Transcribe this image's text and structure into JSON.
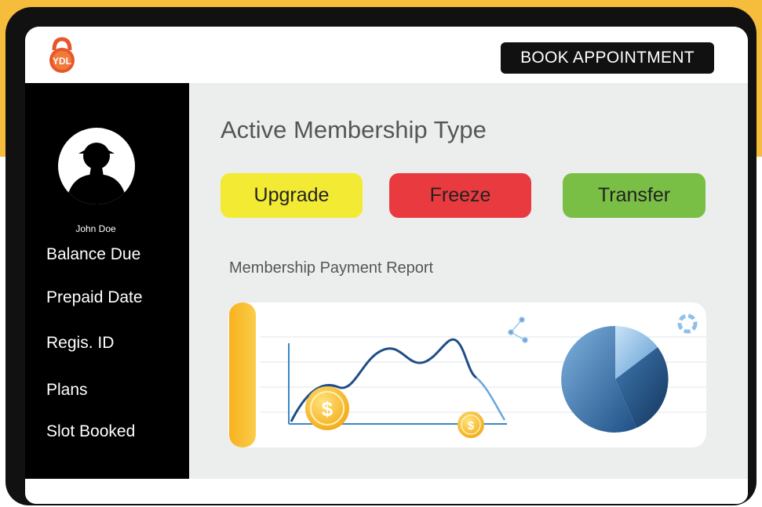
{
  "header": {
    "logo_text": "YDL",
    "book_button_label": "BOOK APPOINTMENT"
  },
  "sidebar": {
    "user_name": "John Doe",
    "items": [
      {
        "label": "Balance Due"
      },
      {
        "label": "Prepaid Date"
      },
      {
        "label": "Regis. ID"
      },
      {
        "label": "Plans"
      },
      {
        "label": "Slot Booked"
      }
    ]
  },
  "main": {
    "title": "Active Membership Type",
    "actions": [
      {
        "label": "Upgrade",
        "color": "#f3ea33"
      },
      {
        "label": "Freeze",
        "color": "#e93a3f"
      },
      {
        "label": "Transfer",
        "color": "#79be45"
      }
    ],
    "report_title": "Membership Payment Report"
  },
  "colors": {
    "accent": "#f6bd3c",
    "frame": "#111111",
    "panel": "#eceeed"
  }
}
